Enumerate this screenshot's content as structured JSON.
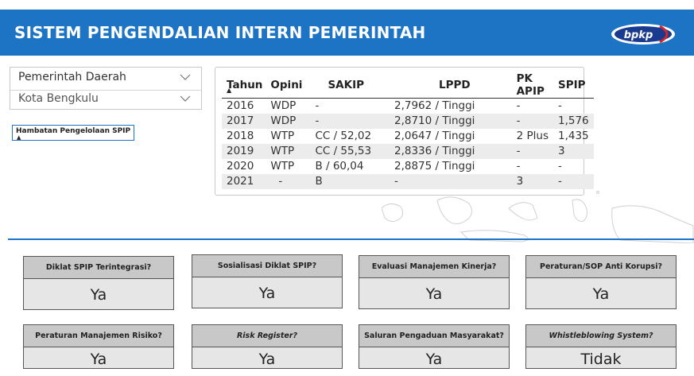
{
  "header": {
    "title": "SISTEM PENGENDALIAN INTERN PEMERINTAH",
    "logo_text": "bpkp",
    "bg_color": "#1d74c4"
  },
  "slicer": {
    "level_value": "Pemerintah Daerah",
    "region_value": "Kota Bengkulu"
  },
  "hambatan_button": "Hambatan Pengelolaan SPIP",
  "table": {
    "columns": [
      "Tahun",
      "Opini",
      "SAKIP",
      "LPPD",
      "PK APIP",
      "SPIP"
    ],
    "rows": [
      [
        "2016",
        "WDP",
        "-",
        "2,7962 / Tinggi",
        "-",
        "-"
      ],
      [
        "2017",
        "WDP",
        "-",
        "2,8710 / Tinggi",
        "-",
        "1,576"
      ],
      [
        "2018",
        "WTP",
        "CC / 52,02",
        "2,0647 / Tinggi",
        "2 Plus",
        "1,435"
      ],
      [
        "2019",
        "WTP",
        "CC / 55,53",
        "2,8336 / Tinggi",
        "-",
        "3"
      ],
      [
        "2020",
        "WTP",
        "B / 60,04",
        "2,8875 / Tinggi",
        "-",
        "-"
      ],
      [
        "2021",
        "-",
        "B",
        "-",
        "3",
        "-"
      ]
    ]
  },
  "cards": [
    {
      "title": "Diklat SPIP Terintegrasi?",
      "value": "Ya"
    },
    {
      "title": "Sosialisasi Diklat SPIP?",
      "value": "Ya"
    },
    {
      "title": "Evaluasi Manajemen Kinerja?",
      "value": "Ya"
    },
    {
      "title": "Peraturan/SOP Anti Korupsi?",
      "value": "Ya"
    },
    {
      "title": "Peraturan Manajemen Risiko?",
      "value": "Ya"
    },
    {
      "title": "Risk Register?",
      "value": "Ya"
    },
    {
      "title": "Saluran Pengaduan Masyarakat?",
      "value": "Ya"
    },
    {
      "title": "Whistleblowing System?",
      "value": "Tidak"
    }
  ]
}
